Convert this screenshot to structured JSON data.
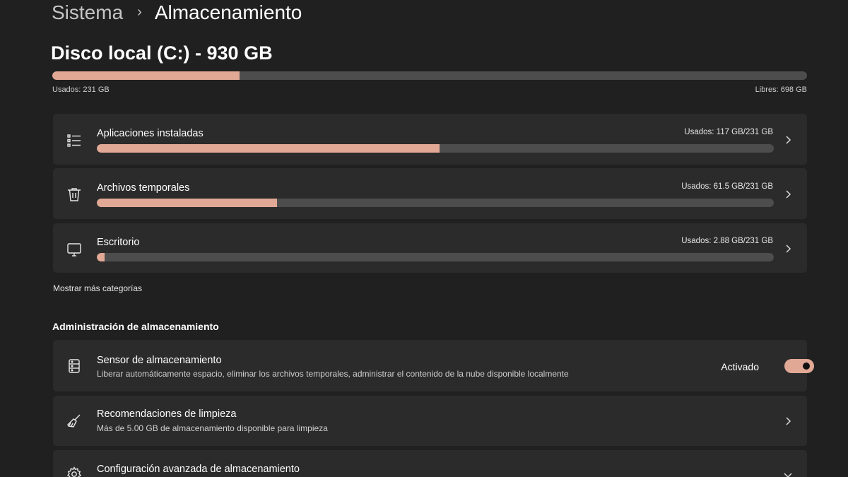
{
  "breadcrumb": {
    "parent": "Sistema",
    "separator": "›",
    "current": "Almacenamiento"
  },
  "disk": {
    "title": "Disco local (C:) - 930 GB",
    "used_label": "Usados: 231 GB",
    "free_label": "Libres: 698 GB",
    "used_fraction": 0.248
  },
  "categories": [
    {
      "icon": "list-icon",
      "label": "Aplicaciones instaladas",
      "usage": "Usados: 117 GB/231 GB",
      "fraction": 0.506
    },
    {
      "icon": "trash-icon",
      "label": "Archivos temporales",
      "usage": "Usados: 61.5 GB/231 GB",
      "fraction": 0.266
    },
    {
      "icon": "monitor-icon",
      "label": "Escritorio",
      "usage": "Usados: 2.88 GB/231 GB",
      "fraction": 0.012
    }
  ],
  "more_categories_label": "Mostrar más categorías",
  "management": {
    "title": "Administración de almacenamiento",
    "items": [
      {
        "icon": "storage-drive-icon",
        "title": "Sensor de almacenamiento",
        "subtitle": "Liberar automáticamente espacio, eliminar los archivos temporales, administrar el contenido de la nube disponible localmente",
        "status": "Activado",
        "toggle_on": true
      },
      {
        "icon": "broom-icon",
        "title": "Recomendaciones de limpieza",
        "subtitle": "Más de 5.00 GB de almacenamiento disponible para limpieza"
      },
      {
        "icon": "gear-icon",
        "title": "Configuración avanzada de almacenamiento"
      }
    ]
  },
  "colors": {
    "accent": "#e2a896",
    "background": "#202020",
    "card": "#2b2b2b",
    "track": "#4d4d4d"
  }
}
